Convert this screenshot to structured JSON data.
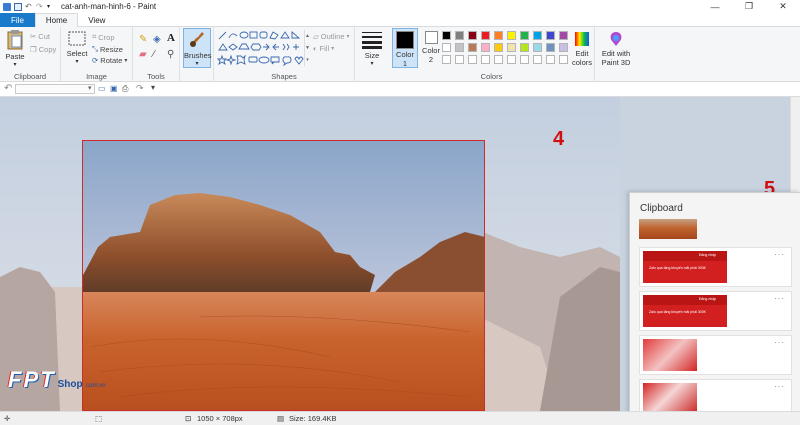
{
  "window": {
    "title": "cat-anh-man-hinh-6 - Paint",
    "min": "—",
    "max": "❐",
    "close": "✕"
  },
  "tabs": [
    "File",
    "Home",
    "View"
  ],
  "ribbon": {
    "clipboard": {
      "paste": "Paste",
      "cut": "Cut",
      "copy": "Copy",
      "label": "Clipboard"
    },
    "image": {
      "select": "Select",
      "crop": "Crop",
      "resize": "Resize",
      "rotate": "Rotate",
      "label": "Image"
    },
    "tools": {
      "label": "Tools",
      "text": "A"
    },
    "brushes": "Brushes",
    "shapes": {
      "outline": "Outline",
      "fill": "Fill",
      "label": "Shapes"
    },
    "size": "Size",
    "color1": [
      "Color",
      "1"
    ],
    "color2": [
      "Color",
      "2"
    ],
    "colors_label": "Colors",
    "edit_colors": [
      "Edit",
      "colors"
    ],
    "edit_paint3d": [
      "Edit with",
      "Paint 3D"
    ],
    "palette": {
      "row1": [
        "#000000",
        "#7f7f7f",
        "#880015",
        "#ed1c24",
        "#ff7f27",
        "#fff200",
        "#22b14c",
        "#00a2e8",
        "#3f48cc",
        "#a349a4"
      ],
      "row2": [
        "#ffffff",
        "#c3c3c3",
        "#b97a57",
        "#ffaec9",
        "#ffc90e",
        "#efe4b0",
        "#b5e61d",
        "#99d9ea",
        "#7092be",
        "#c8bfe7"
      ]
    }
  },
  "markers": {
    "m4": "4",
    "m5": "5"
  },
  "clipboard_panel": {
    "title": "Clipboard",
    "item_banner_text": "Zalo qua tặng khuyến mãi phải 300K",
    "dangnhap": "Đăng nhập",
    "more": "···"
  },
  "watermark": {
    "fpt": "FPT",
    "shop": "Shop",
    "domain": ".com.vn"
  },
  "status": {
    "dimensions": "1050 × 708px",
    "size": "Size: 169.4KB"
  },
  "colors": {
    "accent": "#1979ca",
    "marker": "#d01010"
  }
}
